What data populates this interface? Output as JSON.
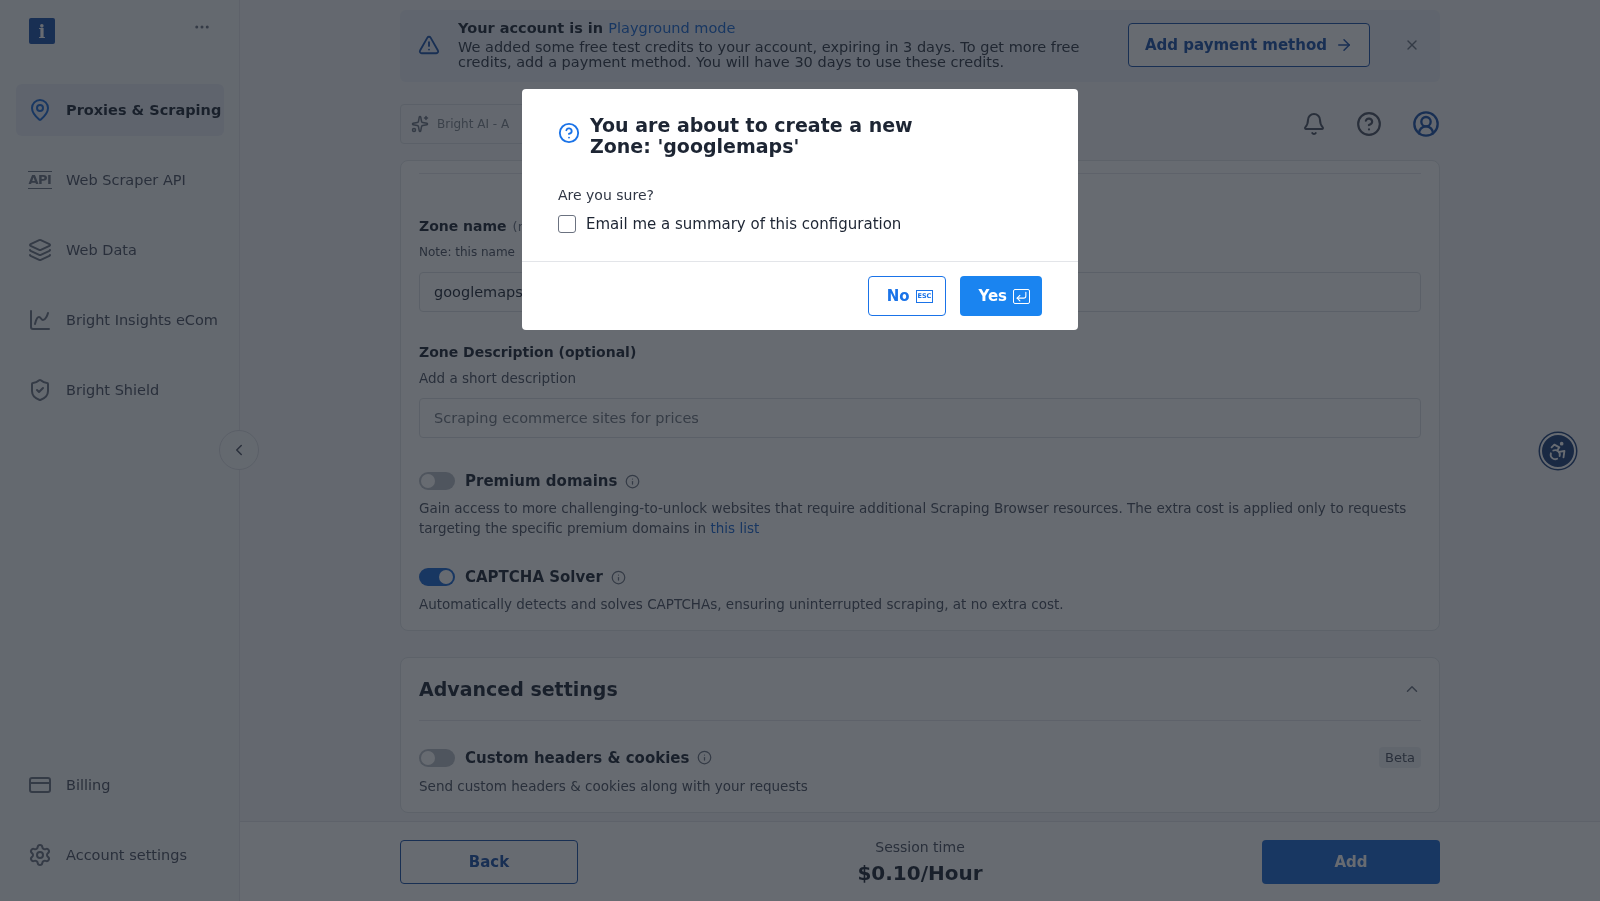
{
  "sidebar": {
    "logo": "i",
    "items": [
      {
        "label": "Proxies & Scraping",
        "selected": true
      },
      {
        "label": "Web Scraper API",
        "icon_text": "API",
        "selected": false
      },
      {
        "label": "Web Data",
        "selected": false
      },
      {
        "label": "Bright Insights eCom",
        "selected": false
      },
      {
        "label": "Bright Shield",
        "selected": false
      }
    ],
    "bottom_items": [
      {
        "label": "Billing",
        "selected": false
      },
      {
        "label": "Account settings",
        "selected": false
      }
    ]
  },
  "banner": {
    "title": "Your account is in ",
    "title_link": "Playground mode",
    "text": "We added some free test credits to your account, expiring in 3 days. To get more free credits, add a payment method. You will have 30 days to use these credits.",
    "button": "Add payment method"
  },
  "search": {
    "placeholder": "Bright AI - A"
  },
  "zone_name": {
    "label": "Zone name",
    "hint": "(r",
    "note": "Note: this name",
    "value": "googlemaps"
  },
  "zone_description": {
    "label": "Zone Description (optional)",
    "hint": "Add a short description",
    "placeholder": "Scraping ecommerce sites for prices"
  },
  "toggles": [
    {
      "label": "Premium domains",
      "on": false,
      "text": "Gain access to more challenging-to-unlock websites that require additional Scraping Browser resources. The extra cost is applied only to requests targeting the specific premium domains in ",
      "link": "this list"
    },
    {
      "label": "CAPTCHA Solver",
      "on": true,
      "text": "Automatically detects and solves CAPTCHAs, ensuring uninterrupted scraping, at no extra cost."
    }
  ],
  "advanced": {
    "title": "Advanced settings",
    "expanded": true,
    "toggles": [
      {
        "label": "Custom headers & cookies",
        "on": false,
        "badge": "Beta",
        "text": "Send custom headers & cookies along with your requests"
      }
    ]
  },
  "footer": {
    "back": "Back",
    "session_label": "Session time",
    "session_price": "$0.10/Hour",
    "add": "Add"
  },
  "dialog": {
    "title": "You are about to create a new Zone: 'googlemaps'",
    "question": "Are you sure?",
    "checkbox": {
      "label": "Email me a summary of this configuration",
      "checked": false
    },
    "no": "No",
    "no_key": "ESC",
    "yes": "Yes"
  }
}
